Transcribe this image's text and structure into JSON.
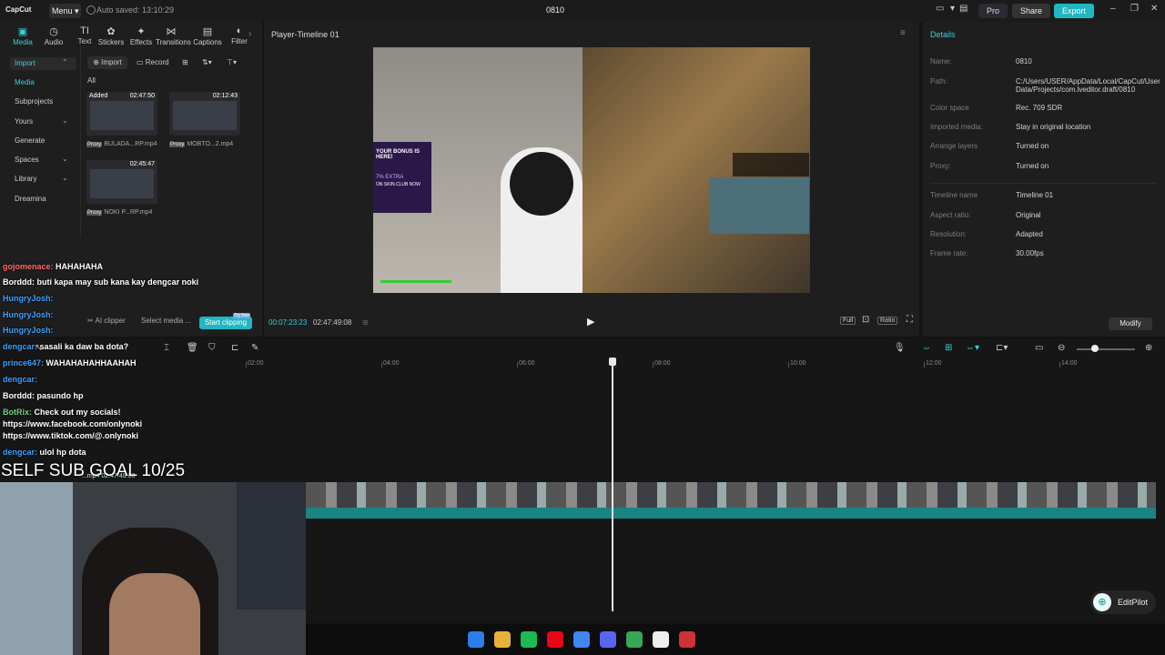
{
  "titlebar": {
    "logo": "CapCut",
    "menu": "Menu",
    "autosave": "Auto saved: 13:10:29",
    "project": "0810",
    "pro": "Pro",
    "share": "Share",
    "export": "Export"
  },
  "left_tabs": [
    {
      "label": "Media",
      "icon": "media-icon",
      "sym": "▣"
    },
    {
      "label": "Audio",
      "icon": "audio-icon",
      "sym": "◷"
    },
    {
      "label": "Text",
      "icon": "text-icon",
      "sym": "TI"
    },
    {
      "label": "Stickers",
      "icon": "stickers-icon",
      "sym": "✿"
    },
    {
      "label": "Effects",
      "icon": "effects-icon",
      "sym": "✦"
    },
    {
      "label": "Transitions",
      "icon": "transitions-icon",
      "sym": "⋈"
    },
    {
      "label": "Captions",
      "icon": "captions-icon",
      "sym": "▤"
    },
    {
      "label": "Filter",
      "icon": "filter-icon",
      "sym": "◐"
    }
  ],
  "categories": [
    "Import",
    "Media",
    "Subprojects",
    "Yours",
    "Generate",
    "Spaces",
    "Library",
    "Dreamina"
  ],
  "import_bar": {
    "import": "Import",
    "record": "Record",
    "all": "All"
  },
  "media": [
    {
      "added": "Added",
      "duration": "02:47:50",
      "proxy": "Proxy",
      "name": "BULADA...RP.mp4"
    },
    {
      "added": "",
      "duration": "02:12:43",
      "proxy": "Proxy",
      "name": "MOBTO...2.mp4"
    },
    {
      "added": "",
      "duration": "02:45:47",
      "proxy": "Proxy",
      "name": "NOKI P...RP.mp4"
    }
  ],
  "ai_clipper": {
    "label": "AI clipper",
    "select": "Select media ...",
    "start": "Start clipping",
    "badge": "Try free"
  },
  "player": {
    "title": "Player-Timeline 01",
    "current": "00:07:23:23",
    "total": "02:47:49:08",
    "full": "Full",
    "ratio": "Ratio"
  },
  "details": {
    "header": "Details",
    "rows": [
      {
        "label": "Name:",
        "value": "0810"
      },
      {
        "label": "Path:",
        "value": "C:/Users/USER/AppData/Local/CapCut/User Data/Projects/com.lveditor.draft/0810"
      },
      {
        "label": "Color space",
        "value": "Rec. 709 SDR"
      },
      {
        "label": "Imported media:",
        "value": "Stay in original location"
      },
      {
        "label": "Arrange layers",
        "value": "Turned on"
      },
      {
        "label": "Proxy:",
        "value": "Turned on"
      },
      {
        "label": "Timeline name",
        "value": "Timeline 01"
      },
      {
        "label": "Aspect ratio:",
        "value": "Original"
      },
      {
        "label": "Resolution:",
        "value": "Adapted"
      },
      {
        "label": "Frame rate:",
        "value": "30.00fps"
      }
    ],
    "modify": "Modify"
  },
  "ruler": [
    "02:00",
    "04:00",
    "06:00",
    "08:00",
    "10:00",
    "12:00",
    "14:00"
  ],
  "clip": {
    "name": "...mp4",
    "duration": "02:47:49:08"
  },
  "chat": [
    {
      "user": "gojomenace:",
      "msg": "HAHAHAHA",
      "cls": "u1"
    },
    {
      "user": "Borddd:",
      "msg": "buti kapa may sub kana kay dengcar noki",
      "cls": ""
    },
    {
      "user": "HungryJosh:",
      "msg": "",
      "cls": "u"
    },
    {
      "user": "HungryJosh:",
      "msg": "",
      "cls": "u"
    },
    {
      "user": "HungryJosh:",
      "msg": "",
      "cls": "u"
    },
    {
      "user": "dengcar:",
      "msg": "sasali ka daw ba dota?",
      "cls": "u"
    },
    {
      "user": "prince647:",
      "msg": "WAHAHAHAHHAAHAH",
      "cls": "u"
    },
    {
      "user": "dengcar:",
      "msg": "",
      "cls": "u"
    },
    {
      "user": "Borddd:",
      "msg": "pasundo hp",
      "cls": ""
    },
    {
      "user": "BotRix:",
      "msg": "Check out my socials!",
      "cls": "u2"
    },
    {
      "user": "",
      "msg": "https://www.facebook.com/onlynoki",
      "cls": ""
    },
    {
      "user": "",
      "msg": "https://www.tiktok.com/@.onlynoki",
      "cls": ""
    },
    {
      "user": "dengcar:",
      "msg": "ulol hp dota",
      "cls": "u"
    }
  ],
  "goal": "SELF SUB GOAL 10/25",
  "editpilot": "EditPilot",
  "video_overlay": {
    "bonus": "YOUR BONUS IS HERE!",
    "extra": "7% EXTRA",
    "site": "ON SKIN.CLUB NOW"
  },
  "taskbar_icons": [
    "windows-icon",
    "folder-icon",
    "spotify-icon",
    "netflix-icon",
    "chrome-icon",
    "discord-icon",
    "chrome-icon",
    "capcut-icon",
    "app-icon"
  ]
}
